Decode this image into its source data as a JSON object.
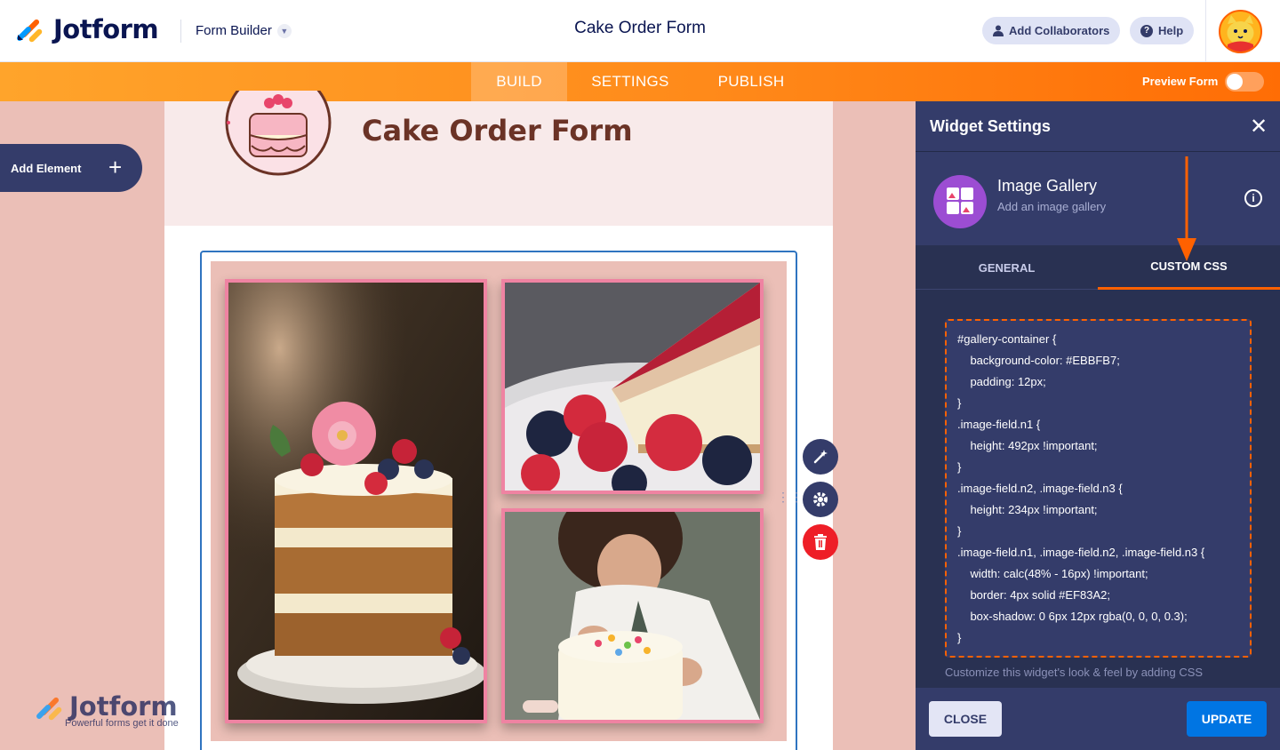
{
  "header": {
    "brand": "Jotform",
    "form_builder": "Form Builder",
    "title": "Cake Order Form",
    "add_collaborators": "Add Collaborators",
    "help": "Help"
  },
  "nav": {
    "tabs": [
      {
        "label": "BUILD",
        "active": true
      },
      {
        "label": "SETTINGS",
        "active": false
      },
      {
        "label": "PUBLISH",
        "active": false
      }
    ],
    "preview_label": "Preview Form",
    "preview_on": false
  },
  "sidebar": {
    "add_element": "Add Element"
  },
  "form": {
    "title": "Cake Order Form",
    "gallery_images": [
      {
        "name": "layered berry cake"
      },
      {
        "name": "cheesecake slice with berries"
      },
      {
        "name": "baker decorating cake"
      }
    ]
  },
  "watermark": {
    "brand": "Jotform",
    "tagline": "Powerful forms get it done"
  },
  "panel": {
    "title": "Widget Settings",
    "widget_name": "Image Gallery",
    "widget_desc": "Add an image gallery",
    "tabs": [
      "GENERAL",
      "CUSTOM CSS"
    ],
    "active_tab": "CUSTOM CSS",
    "css": "#gallery-container {\n    background-color: #EBBFB7;\n    padding: 12px;\n}\n.image-field.n1 {\n    height: 492px !important;\n}\n.image-field.n2, .image-field.n3 {\n    height: 234px !important;\n}\n.image-field.n1, .image-field.n2, .image-field.n3 {\n    width: calc(48% - 16px) !important;\n    border: 4px solid #EF83A2;\n    box-shadow: 0 6px 12px rgba(0, 0, 0, 0.3);\n}",
    "hint": "Customize this widget's look & feel by adding CSS",
    "close_btn": "CLOSE",
    "update_btn": "UPDATE"
  },
  "colors": {
    "orange": "#FF6100",
    "navy": "#343C6A",
    "gallery_bg": "#EBBFB7",
    "image_border": "#EF83A2",
    "update_blue": "#0075E3"
  }
}
